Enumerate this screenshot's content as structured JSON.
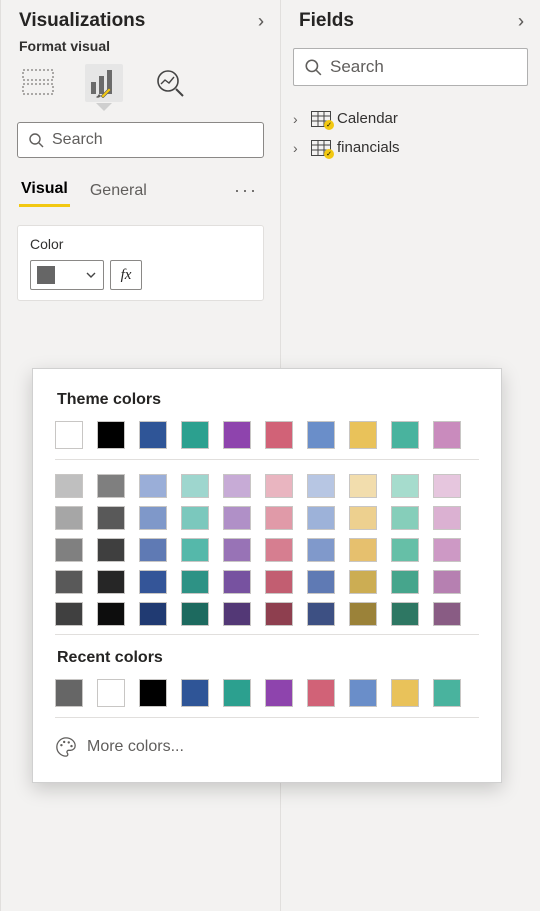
{
  "viz": {
    "title": "Visualizations",
    "subhead": "Format visual",
    "search_placeholder": "Search",
    "tabs": {
      "visual": "Visual",
      "general": "General"
    },
    "color_section": {
      "label": "Color",
      "fx": "fx",
      "current_color": "#666666"
    }
  },
  "fields": {
    "title": "Fields",
    "search_placeholder": "Search",
    "tables": [
      {
        "name": "Calendar"
      },
      {
        "name": "financials"
      }
    ]
  },
  "picker": {
    "theme_label": "Theme colors",
    "recent_label": "Recent colors",
    "more_label": "More colors...",
    "theme_row": [
      "#ffffff",
      "#000000",
      "#2f5597",
      "#2ca08f",
      "#8e44ad",
      "#d16277",
      "#6a8ec9",
      "#e9c25a",
      "#49b39e",
      "#c98bbd"
    ],
    "shade_rows": [
      [
        "#bfbfbf",
        "#7f7f7f",
        "#9aaed8",
        "#9ed6ce",
        "#c7abd6",
        "#e9b5c0",
        "#b7c6e3",
        "#f2ddad",
        "#a6dccd",
        "#e6c6de"
      ],
      [
        "#a6a6a6",
        "#595959",
        "#7f98c9",
        "#7bc8bd",
        "#b090c7",
        "#e09aa8",
        "#9db2d9",
        "#edd08f",
        "#86ceba",
        "#dbb1d2"
      ],
      [
        "#808080",
        "#3f3f3f",
        "#5f7ab4",
        "#55b8aa",
        "#9873b6",
        "#d67e90",
        "#8099cb",
        "#e6c06e",
        "#66bfa7",
        "#cd99c5"
      ],
      [
        "#595959",
        "#262626",
        "#345598",
        "#2e9285",
        "#7752a0",
        "#c25e71",
        "#5f7ab4",
        "#ccad53",
        "#46a58c",
        "#b680b1"
      ],
      [
        "#404040",
        "#0d0d0d",
        "#203a72",
        "#1d6a5f",
        "#533876",
        "#8e3f4f",
        "#3d5083",
        "#9b8239",
        "#2e7763",
        "#895c84"
      ]
    ],
    "recent_row": [
      "#666666",
      "#ffffff",
      "#000000",
      "#2f5597",
      "#2ca08f",
      "#8e44ad",
      "#d16277",
      "#6a8ec9",
      "#e9c25a",
      "#49b39e"
    ]
  }
}
